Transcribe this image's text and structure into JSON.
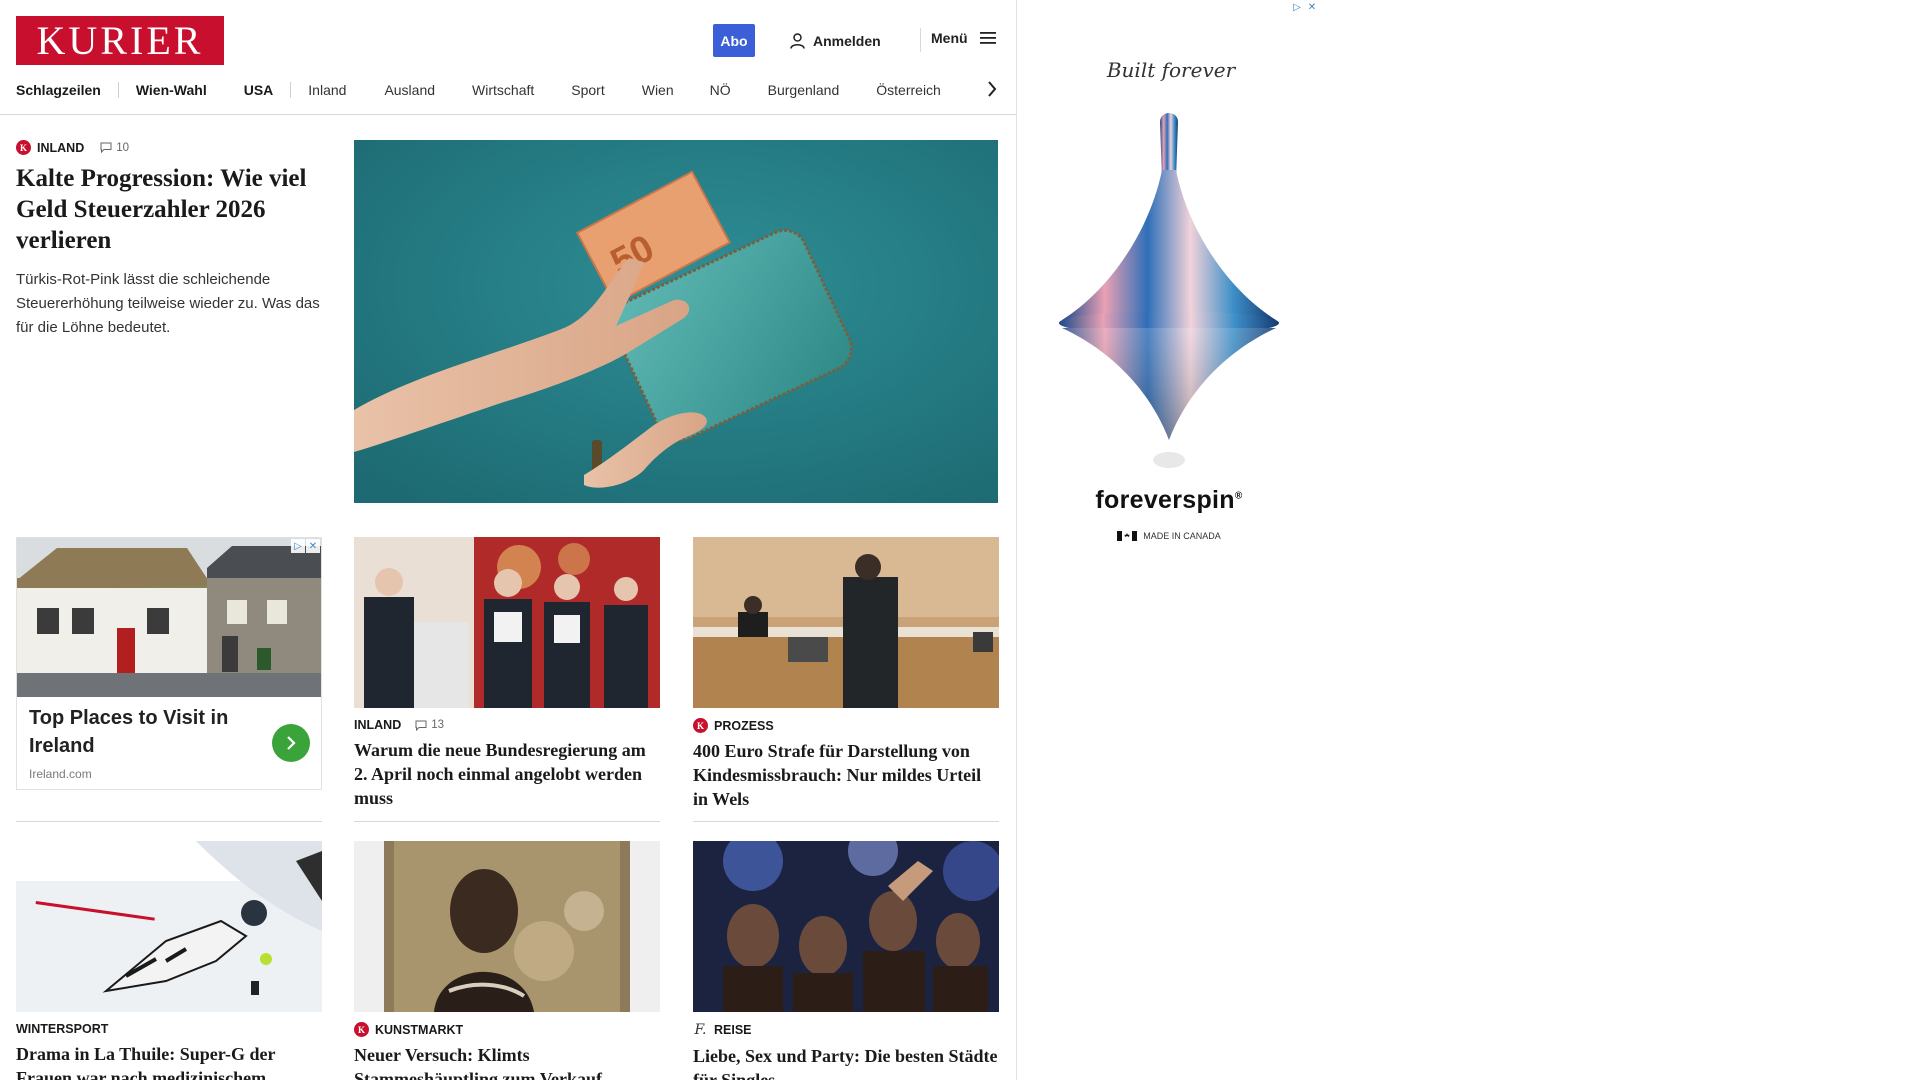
{
  "header": {
    "logo": "KURIER",
    "abo": "Abo",
    "login": "Anmelden",
    "menu": "Menü"
  },
  "nav": {
    "items": [
      "Schlagzeilen",
      "Wien-Wahl",
      "USA",
      "Inland",
      "Ausland",
      "Wirtschaft",
      "Sport",
      "Wien",
      "NÖ",
      "Burgenland",
      "Österreich"
    ]
  },
  "lead": {
    "kicker": "INLAND",
    "comments": "10",
    "headline": "Kalte Progression: Wie viel Geld Steuerzahler 2026 verlieren",
    "teaser": "Türkis-Rot-Pink lässt die schleichende Steuererhöhung teilweise wieder zu. Was das für die Löhne bedeutet.",
    "image_note": "50"
  },
  "native_ad": {
    "title": "Top Places to Visit in Ireland",
    "source": "Ireland.com"
  },
  "cards": [
    {
      "kicker": "INLAND",
      "comments": "13",
      "headline": "Warum die neue Bundesregierung am 2. April noch einmal angelobt werden muss"
    },
    {
      "kicker": "PROZESS",
      "headline": "400 Euro Strafe für Darstellung von Kindesmissbrauch: Nur mildes Urteil in Wels"
    },
    {
      "kicker": "WINTERSPORT",
      "headline": "Drama in La Thuile: Super-G der Frauen war nach medizinischem Notfall unterbrochen"
    },
    {
      "kicker": "KUNSTMARKT",
      "headline": "Neuer Versuch: Klimts Stammeshäuptling zum Verkauf angeboten"
    },
    {
      "kicker": "REISE",
      "headline": "Liebe, Sex und Party: Die besten Städte für Singles"
    }
  ],
  "side_ad": {
    "tagline": "Built forever",
    "brand": "foreverspin",
    "brand_mark": "®",
    "made_in": "MADE IN CANADA"
  },
  "colors": {
    "brand_red": "#c8102e",
    "abo_blue": "#3b5fd6",
    "native_go_green": "#3aa33a"
  }
}
